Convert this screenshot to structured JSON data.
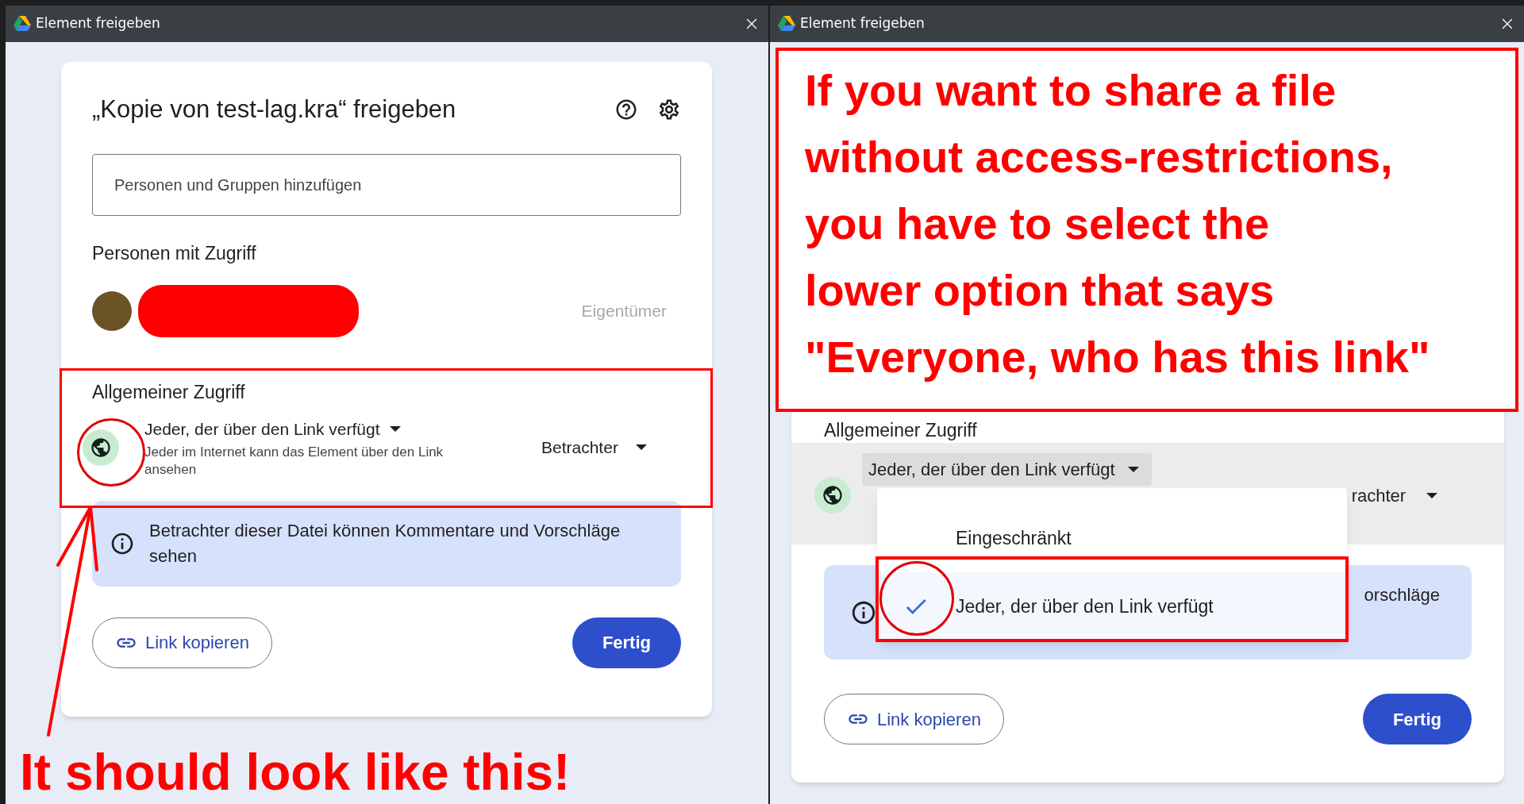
{
  "left_window": {
    "title": "Element freigeben",
    "dialog": {
      "title": "„Kopie von test-lag.kra“ freigeben",
      "add_people": {
        "placeholder": "Personen und Gruppen hinzufügen"
      },
      "people_heading": "Personen mit Zugriff",
      "people": [
        {
          "role": "Eigentümer"
        }
      ],
      "general_access": {
        "heading": "Allgemeiner Zugriff",
        "scope": "Jeder, der über den Link verfügt",
        "scope_description": "Jeder im Internet kann das Element über den Link ansehen",
        "role": "Betrachter"
      },
      "info": "Betrachter dieser Datei können Kommentare und Vorschläge sehen",
      "buttons": {
        "copy_link": "Link kopieren",
        "done": "Fertig"
      }
    },
    "annotation": "It should look like this!"
  },
  "right_window": {
    "title": "Element freigeben",
    "annotation_lines": [
      "If you want to share a file",
      "without access-restrictions,",
      "you have to select the",
      "lower option that says",
      "\"Everyone, who has this link\""
    ],
    "dialog": {
      "general_access": {
        "heading": "Allgemeiner Zugriff",
        "scope": "Jeder, der über den Link verfügt",
        "role": "rachter"
      },
      "scope_menu": {
        "items": [
          {
            "label": "Eingeschränkt",
            "selected": false
          },
          {
            "label": "Jeder, der über den Link verfügt",
            "selected": true
          }
        ]
      },
      "info": "orschläge",
      "buttons": {
        "copy_link": "Link kopieren",
        "done": "Fertig"
      }
    }
  }
}
